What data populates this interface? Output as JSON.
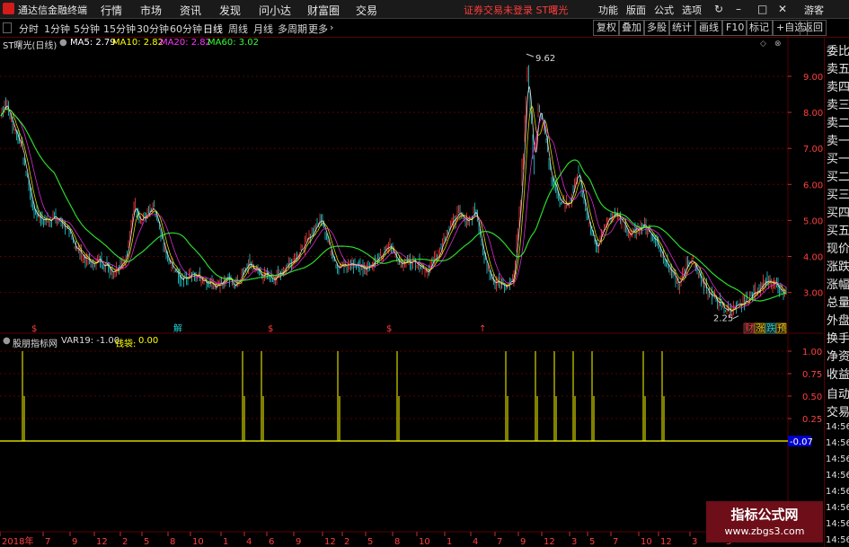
{
  "menubar": {
    "app_title": "通达信金融终端",
    "items": [
      "行情",
      "市场",
      "资讯",
      "发现",
      "问小达",
      "财富圈",
      "交易"
    ],
    "warning": "证券交易未登录  ST曙光",
    "right_items": [
      "功能",
      "版面",
      "公式",
      "选项"
    ],
    "user": "游客"
  },
  "toolbar": {
    "periods": [
      "分时",
      "1分钟",
      "5分钟",
      "15分钟",
      "30分钟",
      "60分钟",
      "日线",
      "周线",
      "月线",
      "多周期",
      "更多"
    ],
    "active_period": "日线",
    "buttons": [
      "复权",
      "叠加",
      "多股",
      "统计",
      "画线",
      "F10",
      "标记",
      "+自选",
      "返回"
    ]
  },
  "main_legend": {
    "stock": "ST曙光(日线)",
    "ma5": "MA5: 2.79",
    "ma10": "MA10: 2.82",
    "ma20": "MA20: 2.82",
    "ma60": "MA60: 3.02"
  },
  "price_axis": [
    "9.00",
    "8.00",
    "7.00",
    "6.00",
    "5.00",
    "4.00",
    "3.00"
  ],
  "annotations": {
    "high": "9.62",
    "low": "2.25",
    "low_dot": "·"
  },
  "event_tags": [
    "$",
    "解",
    "$",
    "$",
    "↑"
  ],
  "end_tags": [
    "财",
    "涨",
    "跌",
    "预"
  ],
  "sub_legend": {
    "name": "股朋指标网",
    "var19": "VAR19: -1.00",
    "qiandai_label": "钱袋:",
    "qiandai_value": "0.00"
  },
  "sub_axis": [
    "1.00",
    "0.75",
    "0.50",
    "0.25"
  ],
  "sub_value_box": "-0.07",
  "x_axis": [
    {
      "label": "2018年"
    },
    {
      "label": "7"
    },
    {
      "label": "9"
    },
    {
      "label": "12"
    },
    {
      "label": "2"
    },
    {
      "label": "5"
    },
    {
      "label": "8"
    },
    {
      "label": "10"
    },
    {
      "label": "1"
    },
    {
      "label": "4"
    },
    {
      "label": "6"
    },
    {
      "label": "9"
    },
    {
      "label": "12"
    },
    {
      "label": "2"
    },
    {
      "label": "5"
    },
    {
      "label": "8"
    },
    {
      "label": "10"
    },
    {
      "label": "1"
    },
    {
      "label": "4"
    },
    {
      "label": "7"
    },
    {
      "label": "9"
    },
    {
      "label": "12"
    },
    {
      "label": "3"
    },
    {
      "label": "5"
    },
    {
      "label": "7"
    },
    {
      "label": "10"
    },
    {
      "label": "12"
    },
    {
      "label": "3"
    },
    {
      "label": "5"
    }
  ],
  "right_panel": {
    "items": [
      "委比",
      "卖五",
      "卖四",
      "卖三",
      "卖二",
      "卖一",
      "买一",
      "买二",
      "买三",
      "买四",
      "买五",
      "现价",
      "涨跌",
      "涨幅",
      "总量",
      "外盘",
      "换手",
      "净资",
      "收益"
    ],
    "auto_trade": [
      "自动",
      "交易"
    ],
    "times": [
      "14:56",
      "14:56",
      "14:56",
      "14:56",
      "14:56",
      "14:56",
      "14:56",
      "14:56",
      "14:56"
    ]
  },
  "watermark": {
    "title": "指标公式网",
    "url": "www.zbgs3.com"
  },
  "colors": {
    "up": "#ff3c3c",
    "down": "#20d0d0",
    "ma5": "#ffffff",
    "ma10": "#ffff00",
    "ma20": "#ff33ff",
    "ma60": "#33ff33",
    "grid": "#5a0000",
    "signal": "#ffff00"
  },
  "chart_data": {
    "type": "candlestick",
    "price_range": [
      2.25,
      9.62
    ],
    "anchors": [
      [
        0,
        7.9
      ],
      [
        4,
        8.3
      ],
      [
        14,
        7.6
      ],
      [
        22,
        7.1
      ],
      [
        28,
        6.3
      ],
      [
        36,
        5.3
      ],
      [
        46,
        5.0
      ],
      [
        58,
        5.1
      ],
      [
        70,
        4.9
      ],
      [
        80,
        4.4
      ],
      [
        88,
        4.1
      ],
      [
        100,
        3.8
      ],
      [
        110,
        3.9
      ],
      [
        125,
        3.6
      ],
      [
        140,
        4.0
      ],
      [
        148,
        5.5
      ],
      [
        155,
        5.0
      ],
      [
        170,
        5.3
      ],
      [
        185,
        3.9
      ],
      [
        200,
        3.4
      ],
      [
        215,
        3.5
      ],
      [
        230,
        3.3
      ],
      [
        240,
        3.2
      ],
      [
        250,
        3.4
      ],
      [
        262,
        3.2
      ],
      [
        275,
        3.8
      ],
      [
        290,
        3.5
      ],
      [
        305,
        3.4
      ],
      [
        320,
        3.8
      ],
      [
        335,
        4.2
      ],
      [
        350,
        4.8
      ],
      [
        357,
        5.1
      ],
      [
        365,
        4.3
      ],
      [
        375,
        3.7
      ],
      [
        390,
        3.8
      ],
      [
        405,
        3.7
      ],
      [
        420,
        3.9
      ],
      [
        432,
        4.3
      ],
      [
        445,
        3.8
      ],
      [
        460,
        3.9
      ],
      [
        475,
        3.6
      ],
      [
        490,
        4.2
      ],
      [
        500,
        4.9
      ],
      [
        510,
        5.2
      ],
      [
        520,
        4.9
      ],
      [
        528,
        5.3
      ],
      [
        538,
        4.0
      ],
      [
        548,
        3.3
      ],
      [
        560,
        3.2
      ],
      [
        570,
        3.3
      ],
      [
        578,
        5.5
      ],
      [
        586,
        9.2
      ],
      [
        593,
        6.5
      ],
      [
        598,
        8.1
      ],
      [
        605,
        7.5
      ],
      [
        612,
        6.2
      ],
      [
        622,
        5.6
      ],
      [
        632,
        5.4
      ],
      [
        642,
        6.4
      ],
      [
        652,
        5.1
      ],
      [
        662,
        4.2
      ],
      [
        672,
        4.9
      ],
      [
        685,
        5.2
      ],
      [
        700,
        4.6
      ],
      [
        715,
        4.9
      ],
      [
        730,
        4.4
      ],
      [
        745,
        3.6
      ],
      [
        755,
        3.2
      ],
      [
        765,
        3.9
      ],
      [
        772,
        3.8
      ],
      [
        782,
        3.2
      ],
      [
        795,
        2.8
      ],
      [
        808,
        2.5
      ],
      [
        822,
        2.6
      ],
      [
        835,
        2.9
      ],
      [
        850,
        3.3
      ],
      [
        862,
        3.2
      ],
      [
        875,
        2.95
      ]
    ],
    "signals_x": [
      25,
      270,
      291,
      376,
      442,
      563,
      596,
      617,
      638,
      659,
      716,
      737
    ]
  }
}
